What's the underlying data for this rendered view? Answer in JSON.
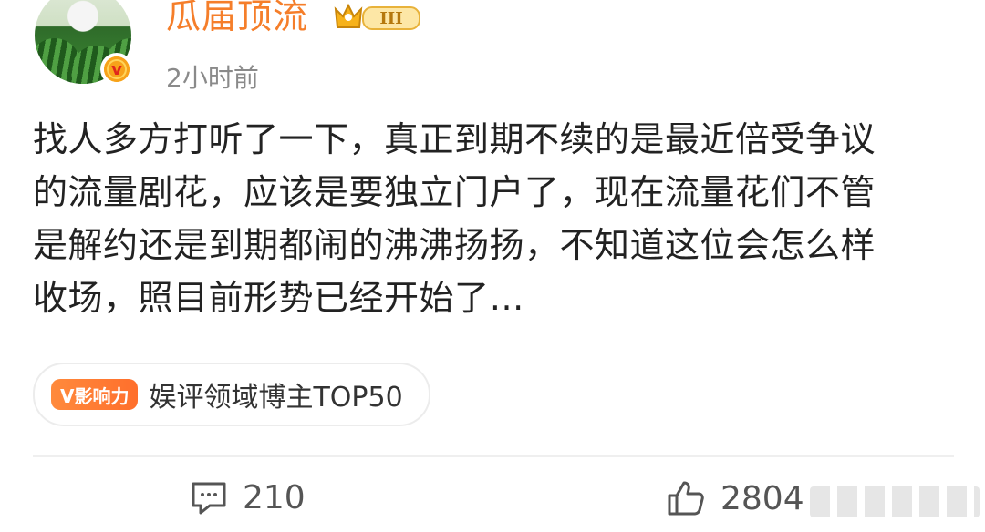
{
  "author": {
    "name": "瓜届顶流",
    "rank_badge": "III",
    "time": "2小时前"
  },
  "post": {
    "lines": [
      "找人多方打听了一下，真正到期不续的是最近倍受争议",
      "的流量剧花，应该是要独立门户了，现在流量花们不管",
      "是解约还是到期都闹的沸沸扬扬，不知道这位会怎么样",
      "收场，照目前形势已经开始了…"
    ]
  },
  "influence": {
    "tag": "V影响力",
    "text": "娱评领域博主TOP50"
  },
  "actions": {
    "comments": "210",
    "likes": "2804"
  },
  "colors": {
    "username": "#f57e2a",
    "accent_orange": "#ff7a2f",
    "badge_gold": "#f7a21a"
  }
}
